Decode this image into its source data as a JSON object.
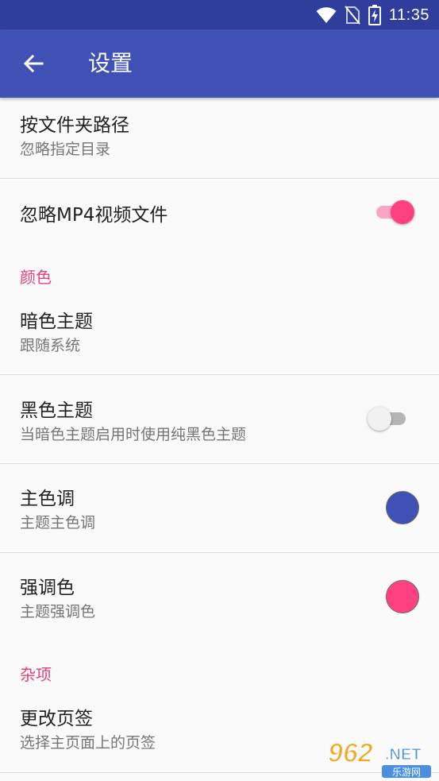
{
  "status_bar": {
    "time": "11:35",
    "icons": [
      "wifi-icon",
      "no-sim-icon",
      "battery-charging-icon"
    ]
  },
  "app_bar": {
    "title": "设置",
    "back_icon": "arrow-left-icon"
  },
  "colors": {
    "primary": "#3f51b5",
    "primary_dark": "#2f3d9c",
    "accent": "#ff4081",
    "section_header": "#e6407e"
  },
  "items": {
    "folder_path": {
      "title": "按文件夹路径",
      "subtitle": "忽略指定目录"
    },
    "ignore_mp4": {
      "title": "忽略MP4视频文件",
      "switch_on": true
    },
    "dark_theme": {
      "title": "暗色主题",
      "subtitle": "跟随系统"
    },
    "black_theme": {
      "title": "黑色主题",
      "subtitle": "当暗色主题启用时使用纯黑色主题",
      "switch_on": false
    },
    "primary_color": {
      "title": "主色调",
      "subtitle": "主题主色调",
      "color": "#3f51b5"
    },
    "accent_color": {
      "title": "强调色",
      "subtitle": "主题强调色",
      "color": "#ff4081"
    },
    "change_tabs": {
      "title": "更改页签",
      "subtitle": "选择主页面上的页签"
    }
  },
  "sections": {
    "color": "颜色",
    "misc": "杂项"
  },
  "watermark": {
    "number": "962",
    "suffix": ".NET",
    "caption": "乐游网"
  }
}
